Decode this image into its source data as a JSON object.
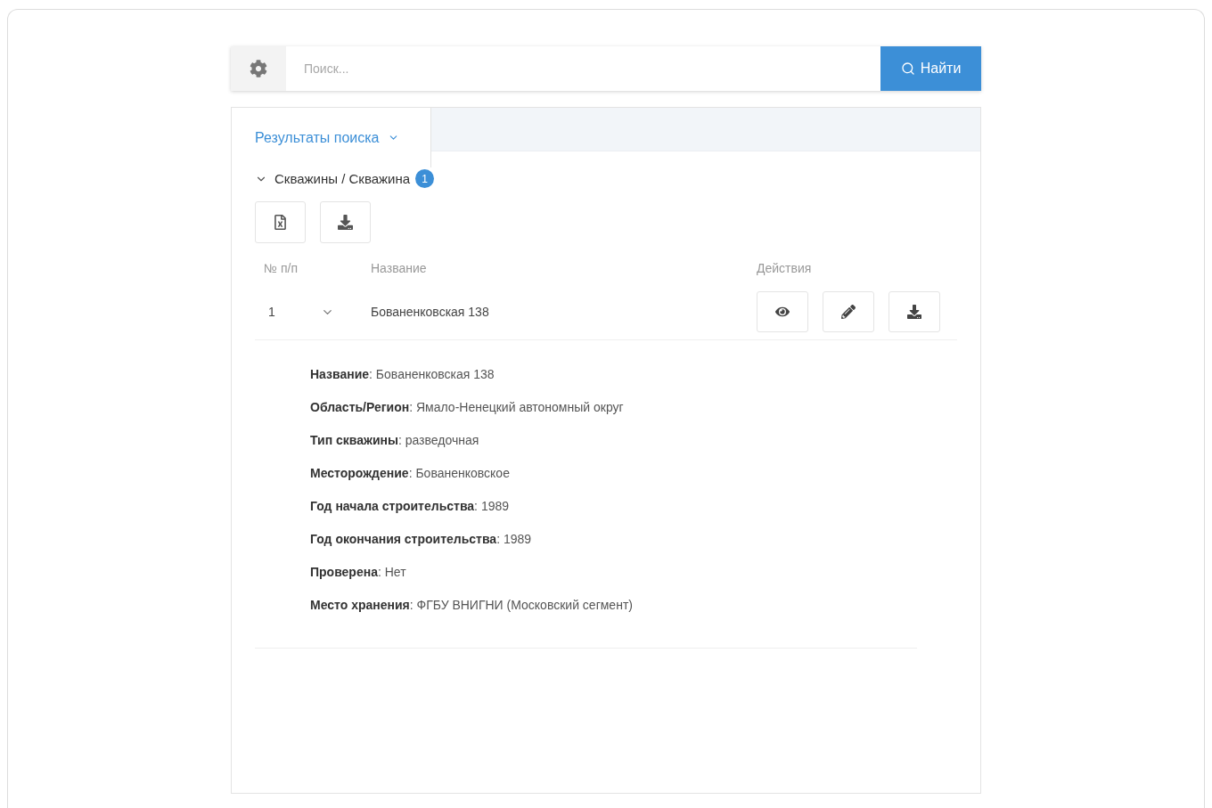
{
  "search": {
    "placeholder": "Поиск...",
    "button": "Найти"
  },
  "tabs": [
    {
      "label": "Результаты поиска",
      "selected": true
    }
  ],
  "section": {
    "title": "Скважины / Скважина",
    "count": "1",
    "expanded": true
  },
  "table": {
    "columns": [
      "№ п/п",
      "Название",
      "Действия"
    ],
    "rows": [
      {
        "number": "1",
        "name": "Бованенковская 138",
        "expanded": true,
        "details": [
          "**Название**: Бованенковская 138",
          "**Область/Регион**: Ямало-Ненецкий автономный округ",
          "**Тип скважины**: разведочная",
          "**Месторождение**: Бованенковское",
          "**Год начала строительства**: 1989",
          "**Год окончания строительства**: 1989",
          "**Проверена**: Нет",
          "**Место хранения**: ФГБУ ВНИГНИ (Московский сегмент)"
        ]
      }
    ]
  }
}
